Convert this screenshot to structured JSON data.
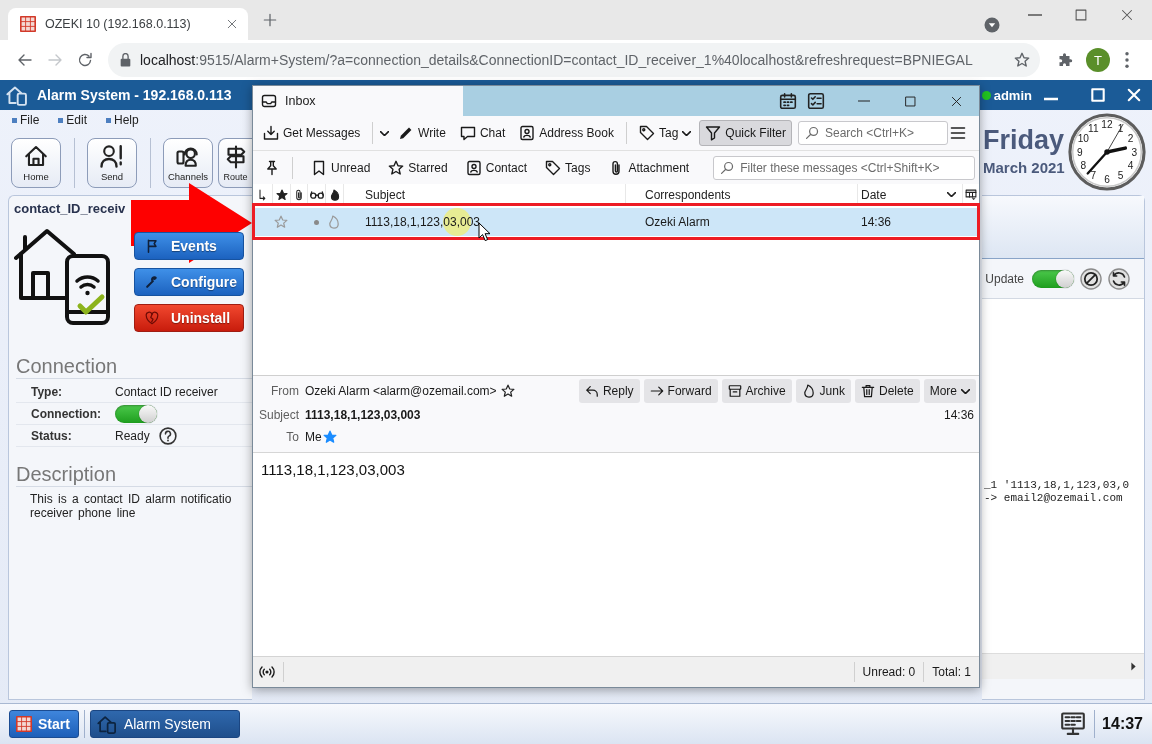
{
  "browser": {
    "tabs": [
      {
        "title": "OZEKI 10 (192.168.0.113)",
        "selected": true
      }
    ],
    "nav": [
      {
        "kind": "back",
        "disabled": false
      },
      {
        "kind": "forward",
        "disabled": true
      },
      {
        "kind": "reload",
        "disabled": false
      }
    ],
    "url": {
      "host": "localhost",
      "rest": ":9515/Alarm+System/?a=connection_details&ConnectionID=contact_ID_receiver_1%40localhost&refreshrequest=BPNIEGAL"
    },
    "profile_initial": "T"
  },
  "app": {
    "title": "Alarm System - 192.168.0.113",
    "user": "admin",
    "user_online": true,
    "menu": [
      "File",
      "Edit",
      "Help"
    ],
    "toolbar": [
      {
        "kind": "home",
        "label": "Home"
      },
      {
        "kind": "send",
        "label": "Send"
      },
      {
        "kind": "channels",
        "label": "Channels"
      },
      {
        "kind": "route",
        "label": "Route"
      }
    ],
    "day": "Friday",
    "date": "March 2021",
    "clock": {
      "numerals": [
        "11",
        "12",
        "1",
        "10",
        "2",
        "9",
        "3",
        "8",
        "4",
        "7",
        "5",
        "6"
      ]
    },
    "connection_panel": {
      "title": "contact_ID_receiv",
      "actions": [
        {
          "kind": "events",
          "label": "Events"
        },
        {
          "kind": "configure",
          "label": "Configure"
        },
        {
          "kind": "uninstall",
          "label": "Uninstall"
        }
      ],
      "section_title": "Connection",
      "fields": [
        {
          "kind": "text",
          "label": "Type:",
          "value": "Contact ID receiver"
        },
        {
          "kind": "toggle",
          "label": "Connection:",
          "on": true
        },
        {
          "kind": "help",
          "label": "Status:",
          "value": "Ready"
        }
      ],
      "description_title": "Description",
      "description_lines": [
        "This is a contact ID alarm notificatio",
        "receiver phone line"
      ]
    },
    "log_panel": {
      "update_label": "Update",
      "update_on": true,
      "lines": [
        "_1 '1113,18,1,123,03,0",
        "-> email2@ozemail.com"
      ]
    },
    "taskbar": {
      "start": "Start",
      "apps": [
        {
          "label": "Alarm System",
          "selected": true
        }
      ],
      "time": "14:37"
    }
  },
  "mail": {
    "tabs": [
      {
        "label": "Inbox",
        "selected": true
      }
    ],
    "toolbar": [
      {
        "kind": "get",
        "label": "Get Messages",
        "pressed": false
      },
      {
        "kind": "write",
        "label": "Write",
        "pressed": false
      },
      {
        "kind": "chat",
        "label": "Chat",
        "pressed": false
      },
      {
        "kind": "addressbook",
        "label": "Address Book",
        "pressed": false
      },
      {
        "kind": "tag",
        "label": "Tag",
        "pressed": false
      },
      {
        "kind": "quickfilter",
        "label": "Quick Filter",
        "pressed": true
      }
    ],
    "search": {
      "placeholder": "Search <Ctrl+K>"
    },
    "filters": [
      {
        "kind": "unread",
        "label": "Unread",
        "on": false
      },
      {
        "kind": "starred",
        "label": "Starred",
        "on": false
      },
      {
        "kind": "contact",
        "label": "Contact",
        "on": false
      },
      {
        "kind": "tags",
        "label": "Tags",
        "on": false
      },
      {
        "kind": "attachment",
        "label": "Attachment",
        "on": false
      }
    ],
    "filter_field": {
      "placeholder": "Filter these messages <Ctrl+Shift+K>"
    },
    "columns": [
      {
        "label": "Subject",
        "sorted": false
      },
      {
        "label": "Correspondents",
        "sorted": false
      },
      {
        "label": "Date",
        "sorted": true
      }
    ],
    "messages": [
      {
        "subject": "1113,18,1,123,03,003",
        "correspondent": "Ozeki Alarm",
        "date": "14:36",
        "selected": true,
        "starred": false,
        "read": true
      }
    ],
    "preview": {
      "from_label": "From",
      "from": "Ozeki Alarm <alarm@ozemail.com>",
      "from_in_contacts": false,
      "actions": [
        {
          "kind": "reply",
          "label": "Reply"
        },
        {
          "kind": "forward",
          "label": "Forward"
        },
        {
          "kind": "archive",
          "label": "Archive"
        },
        {
          "kind": "junk",
          "label": "Junk"
        },
        {
          "kind": "delete",
          "label": "Delete"
        },
        {
          "kind": "more",
          "label": "More"
        }
      ],
      "subject_label": "Subject",
      "subject": "1113,18,1,123,03,003",
      "time": "14:36",
      "to_label": "To",
      "to": "Me",
      "to_in_contacts": true,
      "body": "1113,18,1,123,03,003"
    },
    "status": {
      "unread": "Unread: 0",
      "total": "Total: 1"
    }
  }
}
